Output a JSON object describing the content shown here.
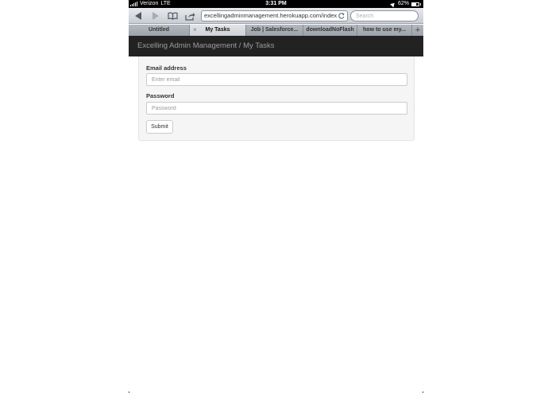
{
  "status_bar": {
    "carrier": "Verizon",
    "network": "LTE",
    "time": "3:31 PM",
    "battery": "62%"
  },
  "toolbar": {
    "url": "excellingadminmanagement.herokuapp.com/index",
    "search_placeholder": "Search",
    "icons": [
      "back-icon",
      "forward-icon",
      "bookmarks-icon",
      "share-icon",
      "reload-icon"
    ]
  },
  "tabs": [
    {
      "label": "Untitled",
      "active": false
    },
    {
      "label": "My Tasks",
      "active": true
    },
    {
      "label": "Job | Salesforce...",
      "active": false
    },
    {
      "label": "downloadNoFlash",
      "active": false
    },
    {
      "label": "how to use my...",
      "active": false
    }
  ],
  "navbar": {
    "brand": "Excelling Admin Management / My Tasks"
  },
  "form": {
    "email_label": "Email address",
    "email_placeholder": "Enter email",
    "password_label": "Password",
    "password_placeholder": "Password",
    "submit_label": "Submit"
  },
  "colors": {
    "navbar_bg": "#222222",
    "brand_text": "#9d9d9d",
    "well_bg": "#f5f5f5"
  }
}
